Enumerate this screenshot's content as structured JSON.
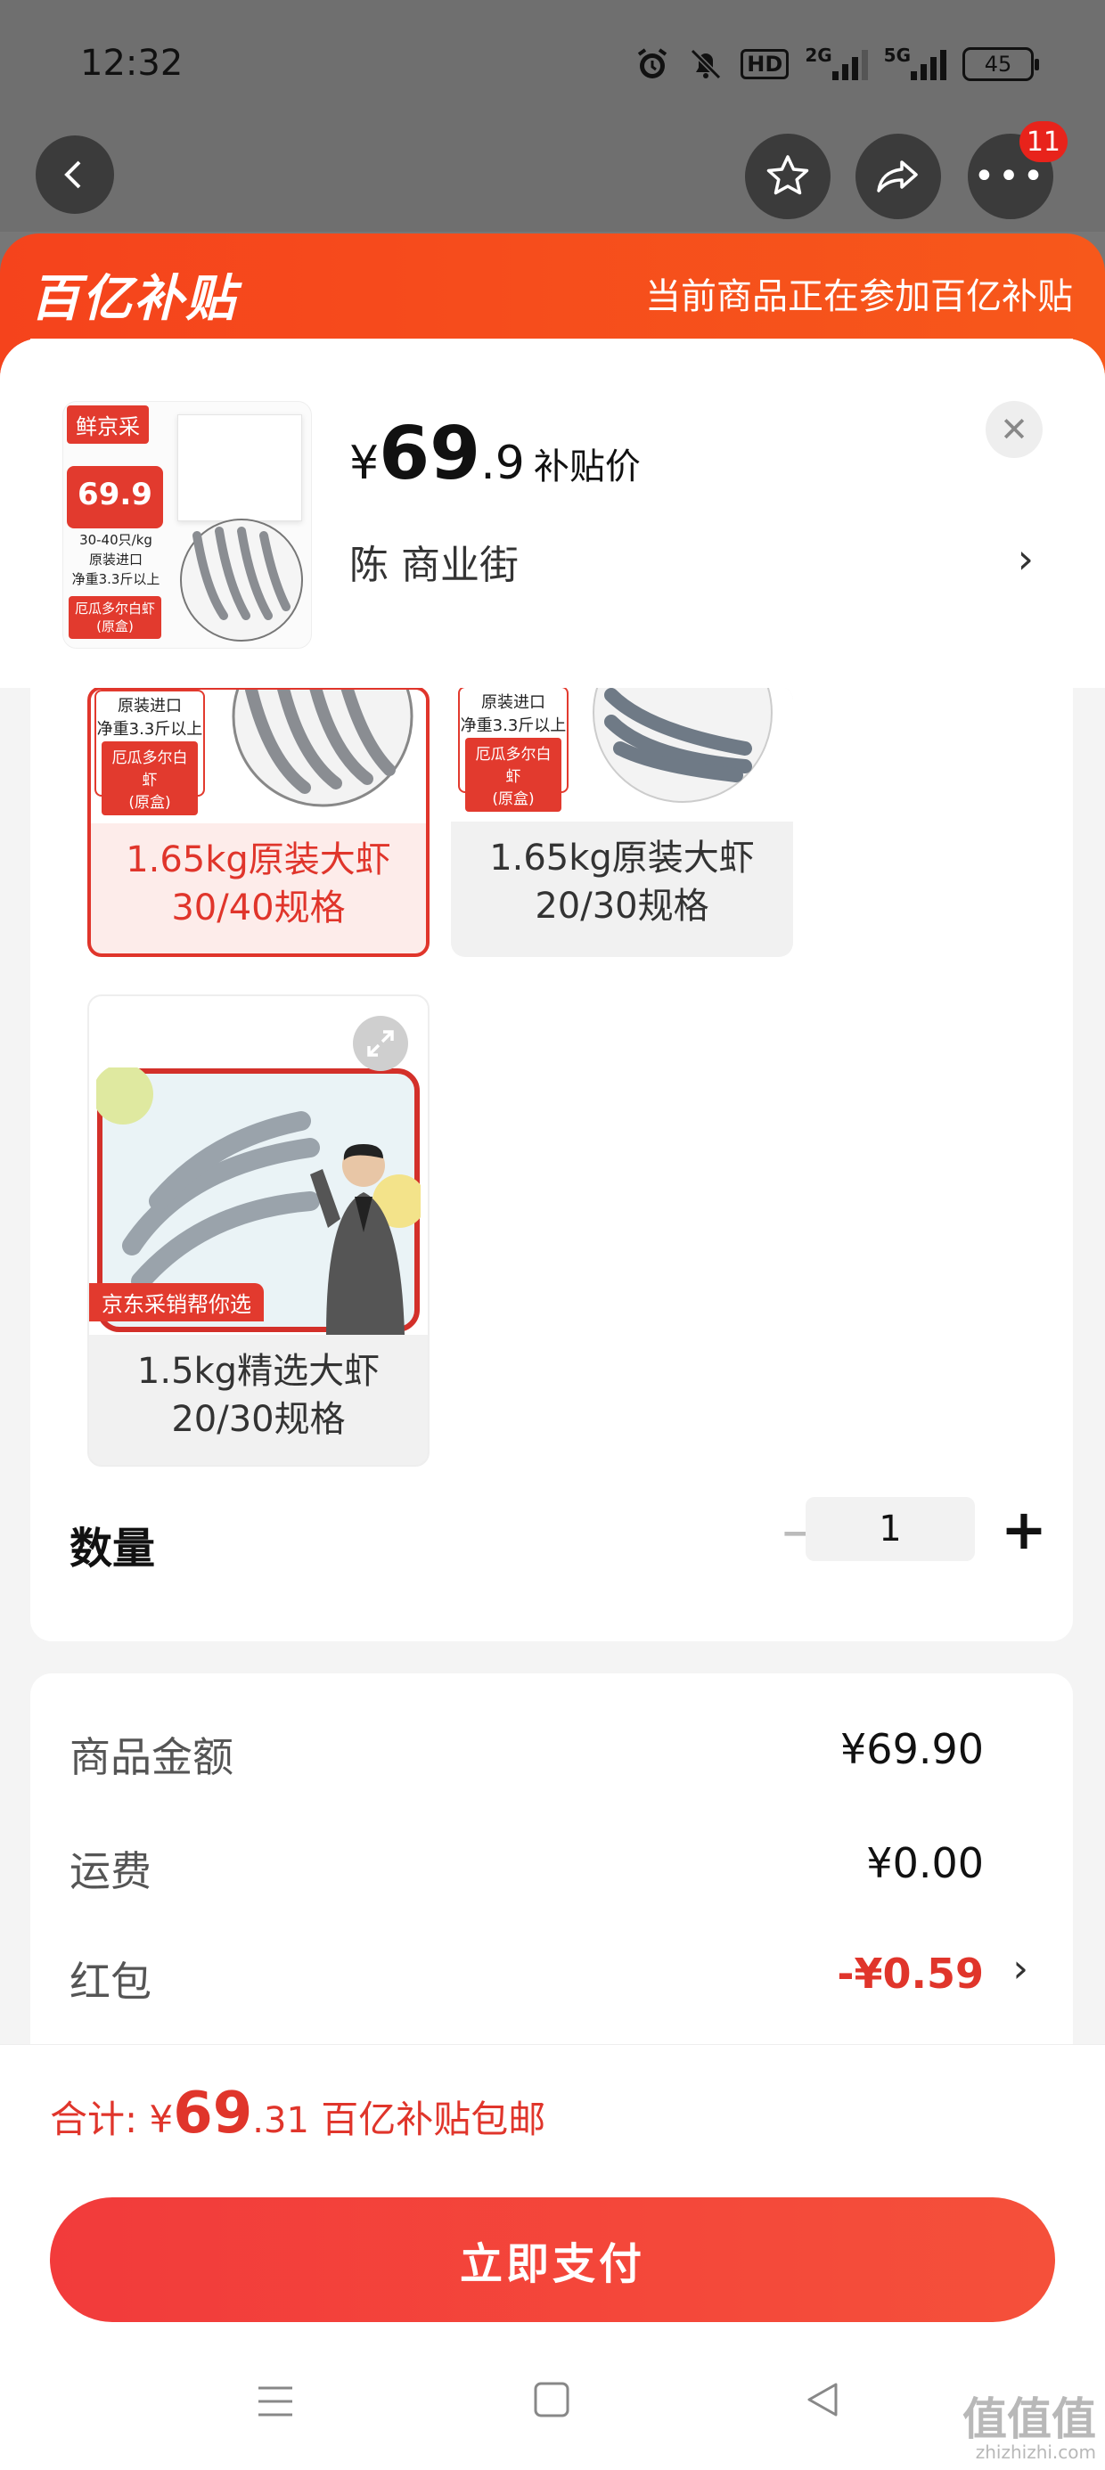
{
  "status": {
    "time": "12:32",
    "net1": "HD",
    "net2": "2G",
    "net3": "5G",
    "battery": "45"
  },
  "nav": {
    "badge_count": "11"
  },
  "banner": {
    "logo_text": "百亿补贴",
    "note": "当前商品正在参加百亿补贴"
  },
  "product": {
    "price_currency": "¥",
    "price_int": "69",
    "price_dec": ".9",
    "price_tag": "补贴价",
    "store": "陈  商业街",
    "thumb": {
      "brand": "鲜京采",
      "price_small": "69.9",
      "spec": "30-40只/kg",
      "origin": "原装进口",
      "weight": "净重3.3斤以上",
      "name": "厄瓜多尔白虾",
      "box": "(原盒)"
    }
  },
  "variants": [
    {
      "label_line1": "1.65kg原装大虾",
      "label_line2": "30/40规格",
      "selected": true
    },
    {
      "label_line1": "1.65kg原装大虾",
      "label_line2": "20/30规格",
      "selected": false
    },
    {
      "label_line1": "1.5kg精选大虾",
      "label_line2": "20/30规格",
      "selected": false,
      "banner": "京东采销帮你选"
    }
  ],
  "variant_crop_text": {
    "origin": "原装进口",
    "weight": "净重3.3斤以上",
    "name": "厄瓜多尔白虾",
    "box": "(原盒)"
  },
  "quantity": {
    "label": "数量",
    "value": "1",
    "minus": "−",
    "plus": "+"
  },
  "summary": {
    "goods_label": "商品金额",
    "goods_value": "¥69.90",
    "shipping_label": "运费",
    "shipping_value": "¥0.00",
    "redpack_label": "红包",
    "redpack_value": "-¥0.59"
  },
  "total": {
    "prefix": "合计: ¥",
    "big": "69",
    "small": ".31",
    "suffix": " 百亿补贴包邮"
  },
  "pay_button": "立即支付",
  "watermark": {
    "main": "值值值",
    "sub": "zhizhizhi.com"
  },
  "colors": {
    "accent": "#e0352b",
    "banner": "#f5431c",
    "pay": "#f23b3b"
  }
}
